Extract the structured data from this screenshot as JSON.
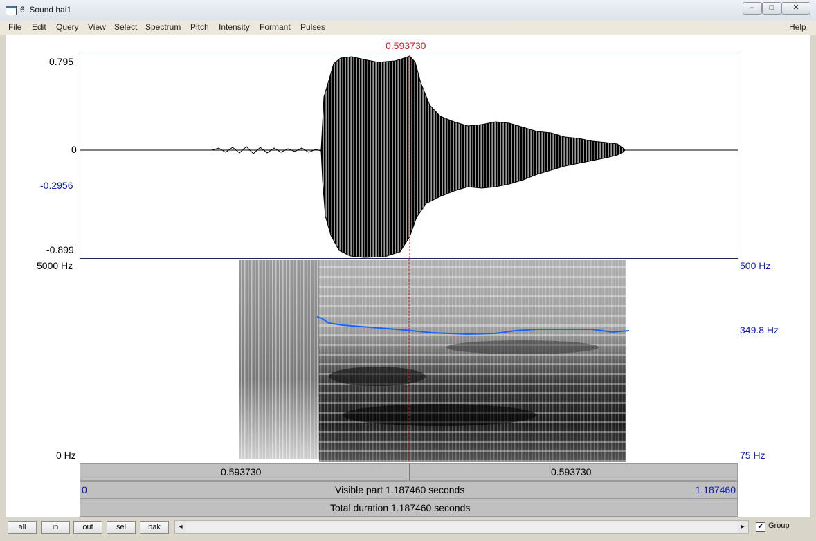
{
  "window": {
    "title": "6. Sound hai1",
    "minimize_glyph": "–",
    "maximize_glyph": "□",
    "close_glyph": "✕"
  },
  "menu": {
    "items": [
      "File",
      "Edit",
      "Query",
      "View",
      "Select",
      "Spectrum",
      "Pitch",
      "Intensity",
      "Formant",
      "Pulses"
    ],
    "help": "Help"
  },
  "cursor": {
    "time": "0.593730"
  },
  "waveform": {
    "y_max": "0.795",
    "y_zero": "0",
    "y_cursor": "-0.2956",
    "y_min": "-0.899"
  },
  "spectrogram": {
    "freq_top": "5000 Hz",
    "freq_bottom": "0 Hz",
    "pitch_top": "500 Hz",
    "pitch_value": "349.8 Hz",
    "pitch_bottom": "75 Hz",
    "pitch_color": "#1565ff"
  },
  "time_bars": {
    "cursor_left": "0.593730",
    "cursor_right": "0.593730",
    "visible_start": "0",
    "visible_label": "Visible part 1.187460 seconds",
    "visible_end": "1.187460",
    "total_label": "Total duration 1.187460 seconds"
  },
  "toolbar": {
    "buttons": [
      "all",
      "in",
      "out",
      "sel",
      "bak"
    ],
    "scroll_left": "◂",
    "scroll_right": "▸",
    "group_label": "Group",
    "group_checked": "✔"
  }
}
